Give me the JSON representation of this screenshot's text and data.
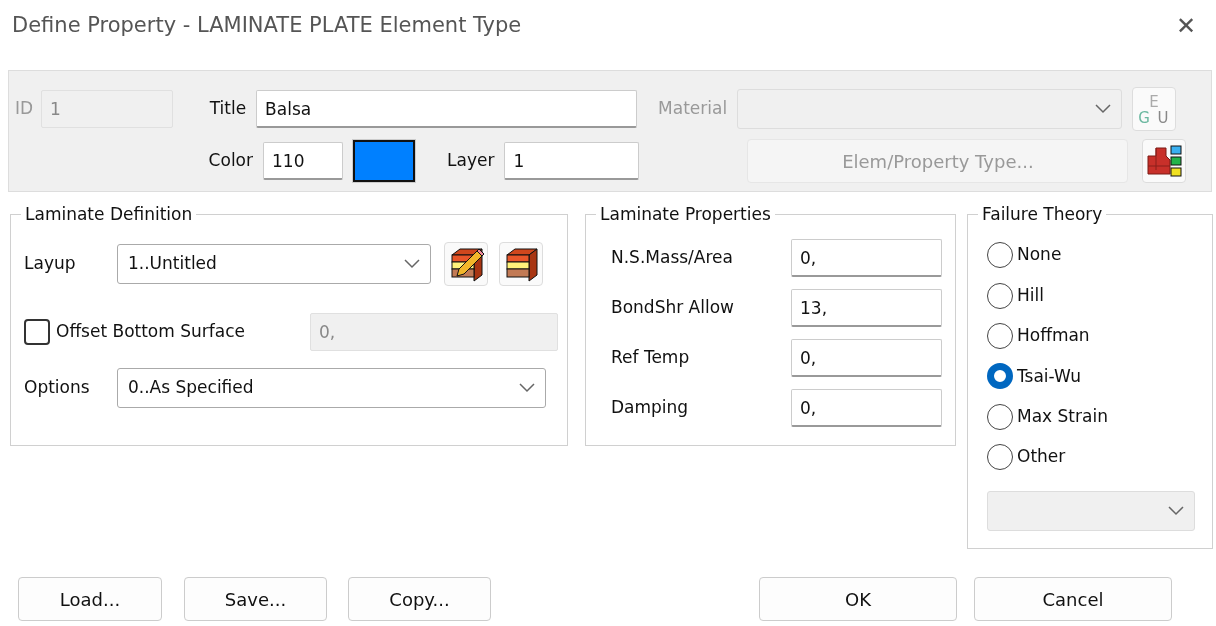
{
  "window": {
    "title": "Define Property - LAMINATE PLATE Element Type",
    "close": "✕"
  },
  "header": {
    "id_label": "ID",
    "id_value": "1",
    "id_disabled": true,
    "title_label": "Title",
    "title_value": "Balsa",
    "material_label": "Material",
    "material_disabled": true,
    "material_icon_letters": [
      "E",
      "G",
      "U"
    ],
    "color_label": "Color",
    "color_value": "110",
    "swatch": {
      "color": "#0080ff"
    },
    "layer_label": "Layer",
    "layer_value": "1",
    "type_button": {
      "label": "Elem/Property Type...",
      "disabled": true
    }
  },
  "laminate_definition": {
    "legend": "Laminate Definition",
    "layup_label": "Layup",
    "layup_value": "1..Untitled",
    "offset": {
      "label": "Offset Bottom Surface",
      "checked": false,
      "value": "0,",
      "disabled": true
    },
    "options_label": "Options",
    "options_value": "0..As Specified"
  },
  "laminate_properties": {
    "legend": "Laminate Properties",
    "fields": [
      {
        "label": "N.S.Mass/Area",
        "value": "0,"
      },
      {
        "label": "BondShr Allow",
        "value": "13,"
      },
      {
        "label": "Ref Temp",
        "value": "0,"
      },
      {
        "label": "Damping",
        "value": "0,"
      }
    ]
  },
  "failure_theory": {
    "legend": "Failure Theory",
    "options": [
      {
        "label": "None",
        "selected": false
      },
      {
        "label": "Hill",
        "selected": false
      },
      {
        "label": "Hoffman",
        "selected": false
      },
      {
        "label": "Tsai-Wu",
        "selected": true
      },
      {
        "label": "Max Strain",
        "selected": false
      },
      {
        "label": "Other",
        "selected": false
      }
    ],
    "dropdown_disabled": true
  },
  "buttons_left": [
    {
      "label": "Load..."
    },
    {
      "label": "Save..."
    },
    {
      "label": "Copy..."
    }
  ],
  "buttons_right": [
    {
      "label": "OK"
    },
    {
      "label": "Cancel"
    }
  ]
}
